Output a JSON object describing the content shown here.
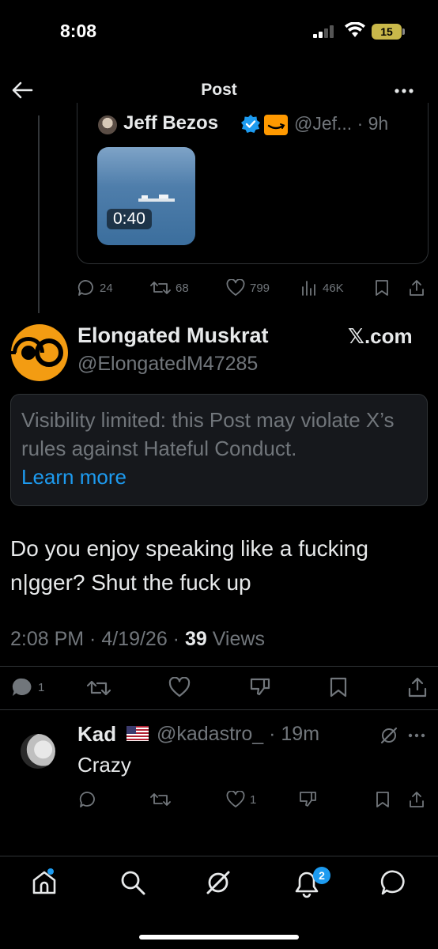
{
  "status_bar": {
    "time": "8:08",
    "battery": "15"
  },
  "header": {
    "title": "Post",
    "back_icon": "arrow-left-icon",
    "more_icon": "more-horizontal-icon"
  },
  "quoted_post": {
    "author_name": "Jeff Bezos",
    "handle_time": "@Jef... · 9h",
    "video_duration": "0:40",
    "actions": {
      "replies": "24",
      "reposts": "68",
      "likes": "799",
      "views": "46K"
    }
  },
  "post": {
    "author_name": "Elongated Muskrat",
    "author_handle": "@ElongatedM47285",
    "badge_text": "𝕏.com",
    "notice_text": "Visibility limited: this Post may violate X’s rules against Hateful Conduct.",
    "notice_link": "Learn more",
    "text": "Do you enjoy speaking like a fucking n|gger?  Shut the fuck up",
    "timestamp": "2:08 PM · 4/19/26 · ",
    "views_count": "39",
    "views_label": " Views",
    "actions": {
      "replies": "1"
    }
  },
  "reply": {
    "author_name": "Kad",
    "handle_time": "@kadastro_ · 19m",
    "text": "Crazy",
    "actions": {
      "likes": "1"
    }
  },
  "bottom_nav": {
    "notifications_badge": "2"
  },
  "colors": {
    "accent": "#1d9bf0",
    "background": "#000000",
    "muted": "#71767b",
    "text": "#e7e9ea",
    "logo_orange": "#f39c12"
  }
}
